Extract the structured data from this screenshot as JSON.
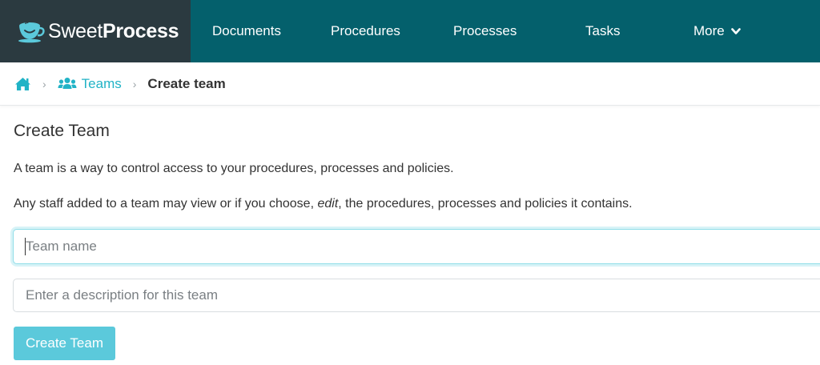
{
  "brand": {
    "name_light": "Sweet",
    "name_bold": "Process",
    "logo_icon": "cup-icon"
  },
  "nav": {
    "items": [
      {
        "label": "Documents"
      },
      {
        "label": "Procedures"
      },
      {
        "label": "Processes"
      },
      {
        "label": "Tasks"
      },
      {
        "label": "More",
        "icon": "chevron-down-icon"
      }
    ]
  },
  "breadcrumb": {
    "home_icon": "home-icon",
    "separator": "›",
    "teams_icon": "users-icon",
    "teams_label": "Teams",
    "current": "Create team"
  },
  "page": {
    "title": "Create Team",
    "intro_1": "A team is a way to control access to your procedures, processes and policies.",
    "intro_2_before": "Any staff added to a team may view or if you choose, ",
    "intro_2_em": "edit",
    "intro_2_after": ", the procedures, processes and policies it contains."
  },
  "form": {
    "name": {
      "placeholder": "Team name",
      "value": ""
    },
    "description": {
      "placeholder": "Enter a description for this team",
      "value": ""
    },
    "submit_label": "Create Team"
  },
  "colors": {
    "nav_bg": "#04606c",
    "brand_bg": "#2b3a40",
    "accent": "#21b3c6",
    "button_bg": "#5bc9db"
  }
}
